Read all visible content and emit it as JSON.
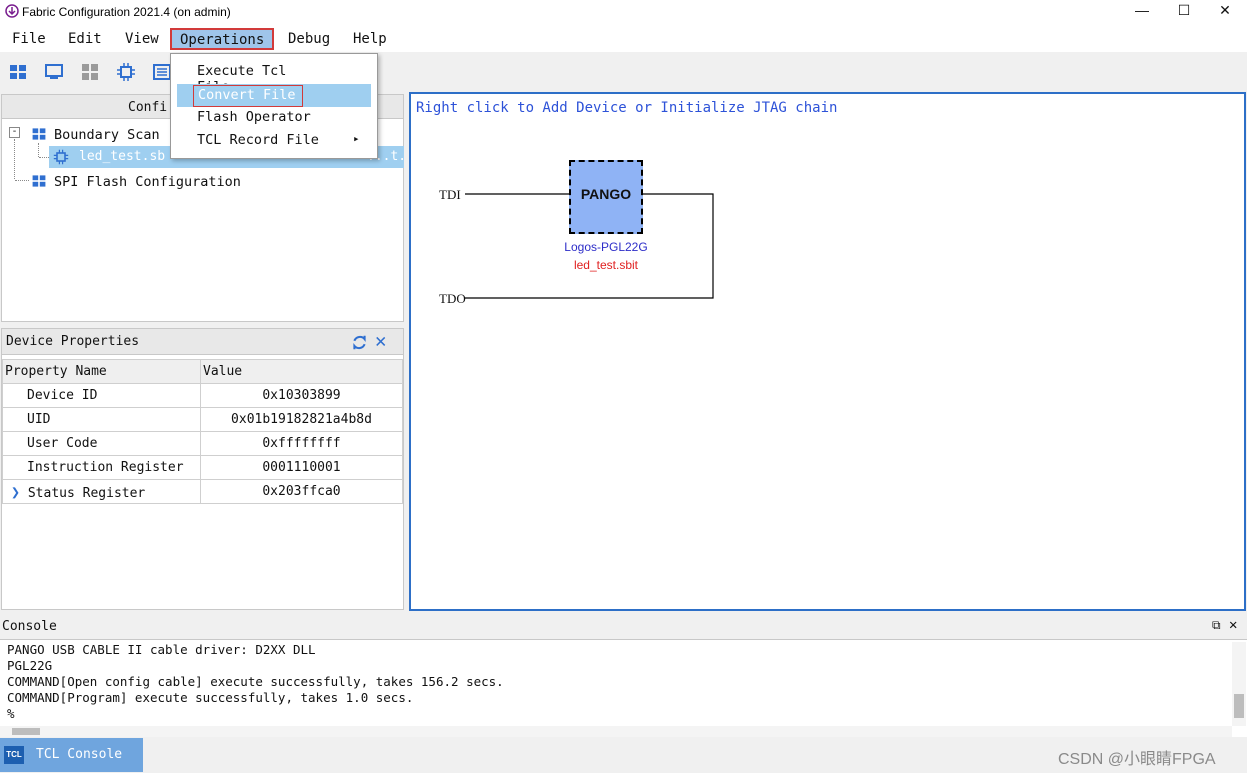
{
  "window": {
    "title": "Fabric Configuration 2021.4 (on admin)",
    "min": "—",
    "max": "☐",
    "close": "✕"
  },
  "menubar": {
    "items": [
      "File",
      "Edit",
      "View",
      "Operations",
      "Debug",
      "Help"
    ]
  },
  "operations_menu": {
    "items": [
      "Execute Tcl File...",
      "Convert File",
      "Flash Operator",
      "TCL Record File"
    ],
    "submenu_arrow": "▸"
  },
  "left_tree": {
    "header": "Confi",
    "root": "Boundary Scan",
    "child": "led_test.sb",
    "child_tail": "...t...",
    "second": "SPI Flash Configuration"
  },
  "device_properties": {
    "title": "Device Properties",
    "columns": [
      "Property Name",
      "Value"
    ],
    "rows": [
      {
        "name": "Device ID",
        "value": "0x10303899"
      },
      {
        "name": "UID",
        "value": "0x01b19182821a4b8d"
      },
      {
        "name": "User Code",
        "value": "0xffffffff"
      },
      {
        "name": "Instruction Register",
        "value": "0001110001"
      },
      {
        "name": "Status Register",
        "value": "0x203ffca0"
      }
    ]
  },
  "canvas": {
    "hint": "Right click to Add Device or Initialize JTAG chain",
    "tdi": "TDI",
    "tdo": "TDO",
    "chip_label": "PANGO",
    "device_name": "Logos-PGL22G",
    "bitfile": "led_test.sbit"
  },
  "console": {
    "title": "Console",
    "lines": [
      "PANGO USB CABLE II cable driver: D2XX DLL",
      "PGL22G",
      "COMMAND[Open config cable] execute successfully, takes 156.2 secs.",
      "COMMAND[Program] execute successfully, takes 1.0 secs.",
      "%"
    ]
  },
  "bottom_tab": {
    "icon": "TCL",
    "label": "TCL Console"
  },
  "watermark": "CSDN @小眼睛FPGA",
  "colors": {
    "accent": "#2d6fc7",
    "selection": "#9fcff0",
    "highlight_border": "#d23a3a",
    "chip": "#8fb3f5"
  }
}
